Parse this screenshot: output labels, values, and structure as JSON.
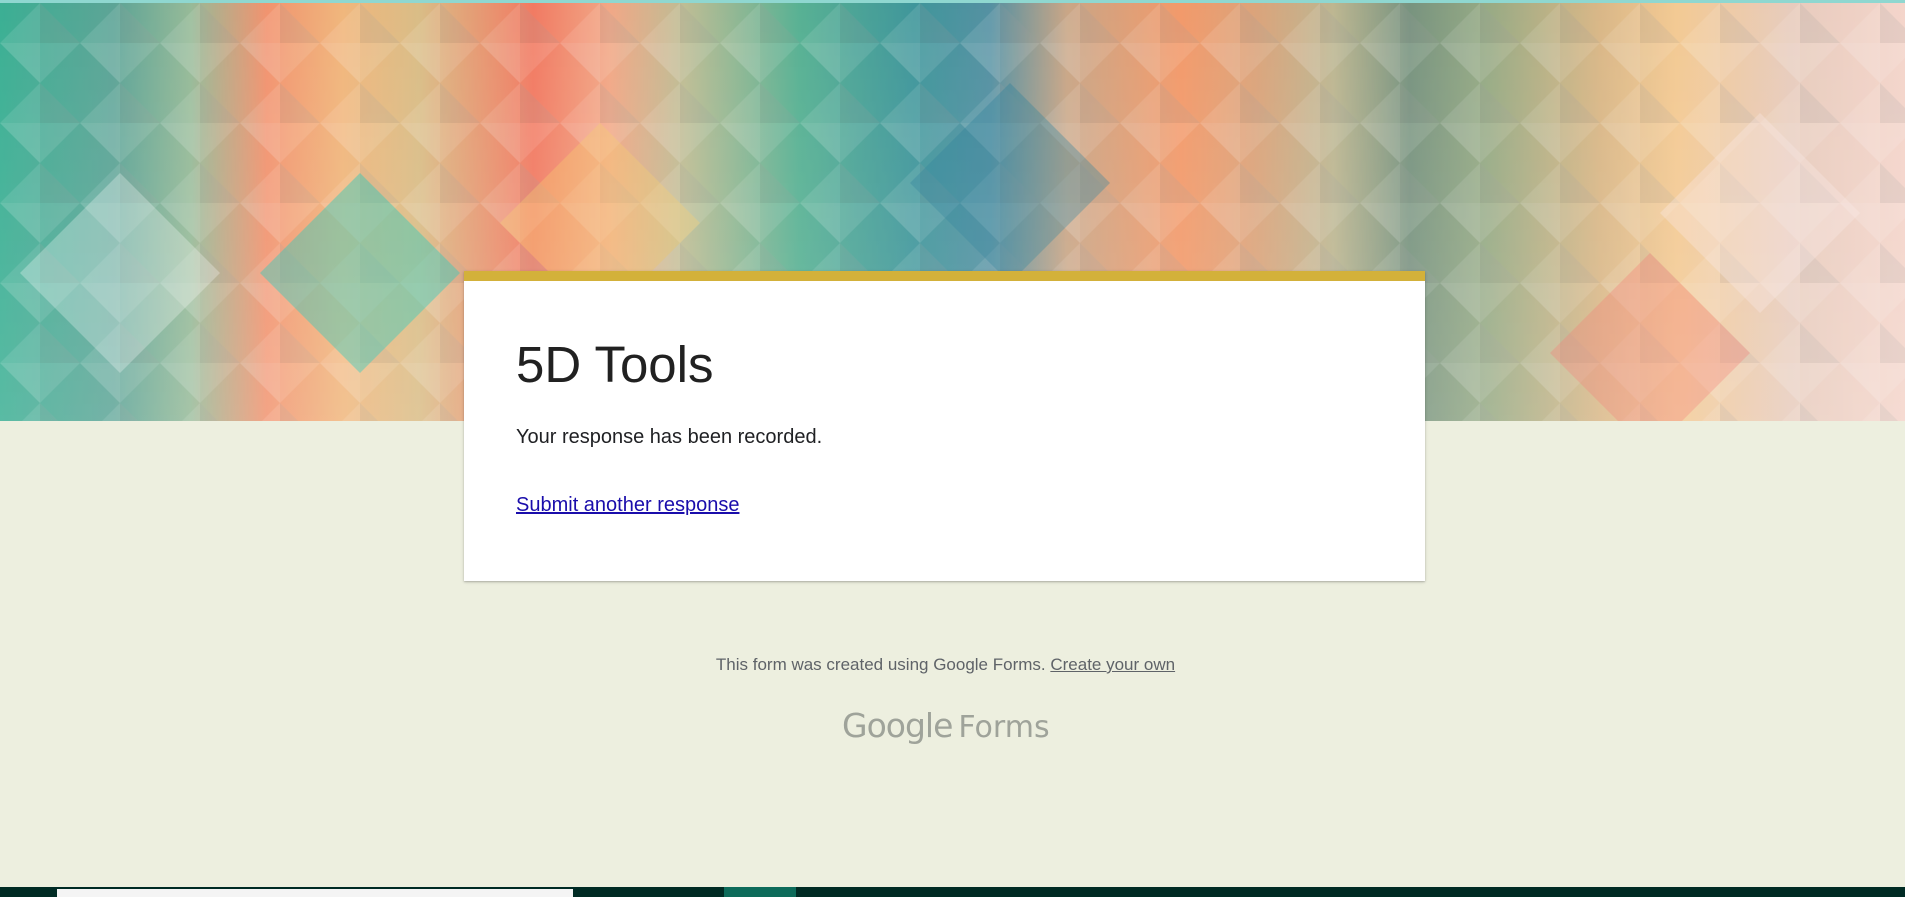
{
  "form": {
    "title": "5D Tools",
    "confirmation_message": "Your response has been recorded.",
    "submit_another_label": "Submit another response"
  },
  "footer": {
    "created_text": "This form was created using Google Forms.",
    "create_own_label": "Create your own",
    "logo_google": "Google",
    "logo_forms": "Forms"
  },
  "colors": {
    "page_background": "#edefdf",
    "card_accent": "#d3b13a",
    "link": "#1a0dab"
  }
}
